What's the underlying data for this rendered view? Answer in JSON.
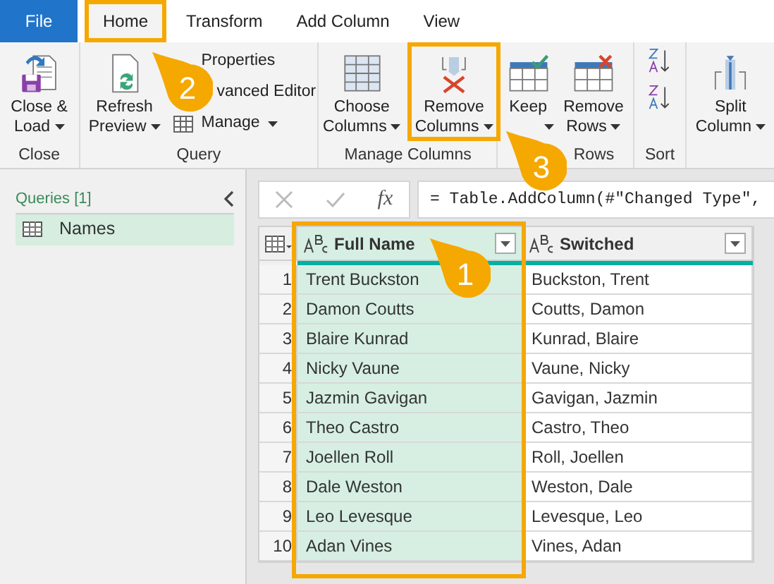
{
  "tabs": [
    {
      "label": "File",
      "kind": "file",
      "selected": false,
      "highlighted": false
    },
    {
      "label": "Home",
      "kind": "tab",
      "selected": true,
      "highlighted": true
    },
    {
      "label": "Transform",
      "kind": "tab",
      "selected": false,
      "highlighted": false
    },
    {
      "label": "Add Column",
      "kind": "tab",
      "selected": false,
      "highlighted": false
    },
    {
      "label": "View",
      "kind": "tab",
      "selected": false,
      "highlighted": false
    }
  ],
  "ribbon": {
    "groups": [
      {
        "label": "Close",
        "buttons": [
          {
            "kind": "large",
            "lines": [
              "Close &",
              "Load"
            ],
            "dropdown": true,
            "highlighted": false
          }
        ]
      },
      {
        "label": "Query",
        "buttons": [
          {
            "kind": "large",
            "lines": [
              "Refresh",
              "Preview"
            ],
            "dropdown": true,
            "highlighted": false
          },
          {
            "kind": "stack",
            "items": [
              {
                "label": "Properties",
                "dropdown": false
              },
              {
                "label": "vanced Editor",
                "dropdown": false
              },
              {
                "label": "Manage",
                "dropdown": true
              }
            ]
          }
        ]
      },
      {
        "label": "Manage Columns",
        "buttons": [
          {
            "kind": "large",
            "lines": [
              "Choose",
              "Columns"
            ],
            "dropdown": true,
            "highlighted": false
          },
          {
            "kind": "large",
            "lines": [
              "Remove",
              "Columns"
            ],
            "dropdown": true,
            "highlighted": true
          }
        ]
      },
      {
        "label": "Rows",
        "buttons": [
          {
            "kind": "large",
            "lines": [
              "Keep"
            ],
            "dropdown": true,
            "highlighted": false
          },
          {
            "kind": "large",
            "lines": [
              "Remove",
              "Rows"
            ],
            "dropdown": true,
            "highlighted": false
          }
        ]
      },
      {
        "label": "Sort",
        "buttons": [
          {
            "kind": "sort"
          }
        ]
      },
      {
        "buttons": [
          {
            "kind": "large",
            "lines": [
              "Split",
              "Column"
            ],
            "dropdown": true,
            "highlighted": false
          }
        ]
      }
    ]
  },
  "queries": {
    "title": "Queries [1]",
    "items": [
      {
        "name": "Names",
        "selected": true
      }
    ]
  },
  "formula_bar": {
    "fx": "fx",
    "formula": "= Table.AddColumn(#\"Changed Type\","
  },
  "table": {
    "columns": [
      {
        "name": "Full Name",
        "selected": true,
        "highlighted": true
      },
      {
        "name": "Switched",
        "selected": false,
        "highlighted": false
      }
    ],
    "rows": [
      {
        "number": "1",
        "cells": [
          "Trent Buckston",
          "Buckston, Trent"
        ]
      },
      {
        "number": "2",
        "cells": [
          "Damon Coutts",
          "Coutts, Damon"
        ]
      },
      {
        "number": "3",
        "cells": [
          "Blaire Kunrad",
          "Kunrad, Blaire"
        ]
      },
      {
        "number": "4",
        "cells": [
          "Nicky Vaune",
          "Vaune, Nicky"
        ]
      },
      {
        "number": "5",
        "cells": [
          "Jazmin Gavigan",
          "Gavigan, Jazmin"
        ]
      },
      {
        "number": "6",
        "cells": [
          "Theo Castro",
          "Castro, Theo"
        ]
      },
      {
        "number": "7",
        "cells": [
          "Joellen Roll",
          "Roll, Joellen"
        ]
      },
      {
        "number": "8",
        "cells": [
          "Dale Weston",
          "Weston, Dale"
        ]
      },
      {
        "number": "9",
        "cells": [
          "Leo Levesque",
          "Levesque, Leo"
        ]
      },
      {
        "number": "10",
        "cells": [
          "Adan Vines",
          "Vines, Adan"
        ]
      }
    ]
  },
  "callouts": [
    {
      "label": "2"
    },
    {
      "label": "3"
    },
    {
      "label": "1"
    }
  ]
}
